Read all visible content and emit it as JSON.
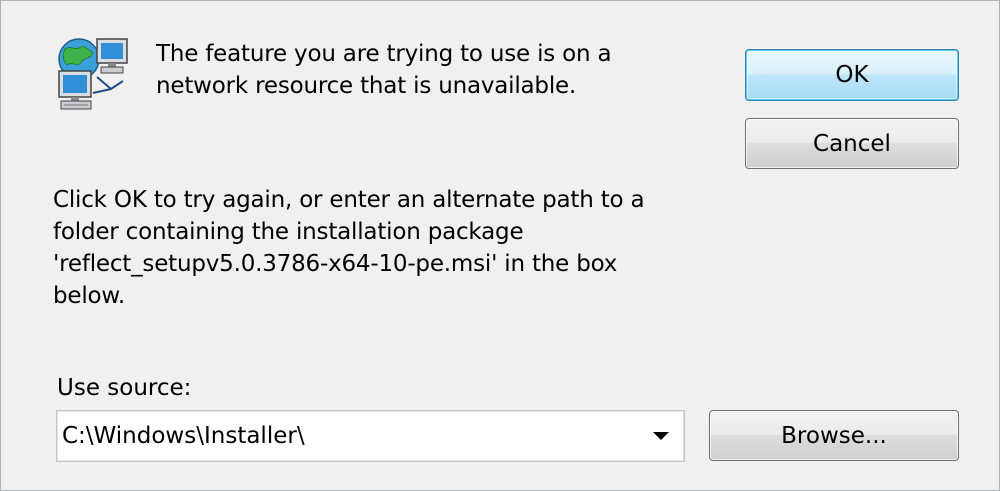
{
  "message": {
    "main": "The feature you are trying to use is on a\nnetwork resource that is unavailable.",
    "detail": "Click OK to try again, or enter an alternate path to a\nfolder containing the installation package\n'reflect_setupv5.0.3786-x64-10-pe.msi' in the box\nbelow."
  },
  "buttons": {
    "ok": "OK",
    "cancel": "Cancel",
    "browse": "Browse..."
  },
  "source": {
    "label": "Use source:",
    "value": "C:\\Windows\\Installer\\"
  },
  "icons": {
    "network": "network-computers-icon",
    "dropdown": "chevron-down-icon"
  },
  "colors": {
    "dialog_background": "#f0f0f0",
    "default_button_border": "#3c7fb1",
    "default_button_fill": "#bee6fd"
  }
}
